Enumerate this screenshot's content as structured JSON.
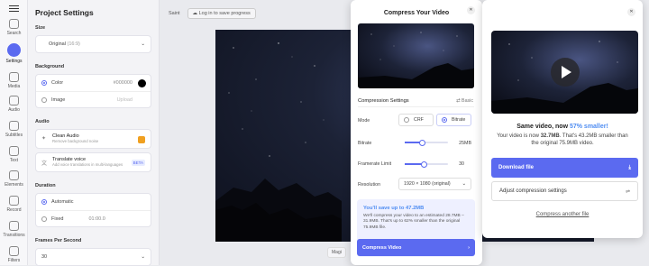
{
  "rail": {
    "items": [
      {
        "label": "Search",
        "icon": "search-icon"
      },
      {
        "label": "Settings",
        "icon": "settings-icon"
      },
      {
        "label": "Media",
        "icon": "plus-icon"
      },
      {
        "label": "Audio",
        "icon": "music-icon"
      },
      {
        "label": "Subtitles",
        "icon": "subtitles-icon"
      },
      {
        "label": "Text",
        "icon": "text-icon"
      },
      {
        "label": "Elements",
        "icon": "elements-icon"
      },
      {
        "label": "Record",
        "icon": "record-icon"
      },
      {
        "label": "Transitions",
        "icon": "transitions-icon"
      },
      {
        "label": "Filters",
        "icon": "filters-icon"
      }
    ]
  },
  "settings": {
    "title": "Project Settings",
    "size_label": "Size",
    "size_value": "Original",
    "size_ratio": "(16:9)",
    "background_label": "Background",
    "color_label": "Color",
    "color_value": "#000000",
    "image_label": "Image",
    "upload_label": "Upload",
    "audio_label": "Audio",
    "clean_audio_title": "Clean Audio",
    "clean_audio_desc": "Remove background noise",
    "translate_title": "Translate voice",
    "translate_desc": "Add voice translations in multi-languages",
    "beta_badge": "BETA",
    "duration_label": "Duration",
    "automatic_label": "Automatic",
    "fixed_label": "Fixed",
    "fixed_value": "01:00.0",
    "fps_label": "Frames Per Second",
    "fps_value": "30"
  },
  "topbar": {
    "project_name": "Saint",
    "save_label": "Log in to save progress"
  },
  "canvas": {
    "magic_label": "Magi"
  },
  "compress": {
    "title": "Compress Your Video",
    "settings_label": "Compression Settings",
    "basic_label": "Basic",
    "mode_label": "Mode",
    "crf_label": "CRF",
    "bitrate_option": "Bitrate",
    "bitrate_label": "Bitrate",
    "bitrate_value": "25MB",
    "bitrate_level": 0.4,
    "framerate_label": "Framerate Limit",
    "framerate_value": "30",
    "framerate_level": 0.45,
    "resolution_label": "Resolution",
    "resolution_value": "1920 × 1080 (original)",
    "save_title": "You'll save up to 47.2MB",
    "save_text": "We'll compress your video to an estimated 28.7MB – 31.9MB. That's up to 62% smaller than the original 75.9MB file.",
    "cta_label": "Compress Video"
  },
  "result": {
    "headline_prefix": "Same video, now ",
    "headline_highlight": "57% smaller!",
    "desc_prefix": "Your video is now ",
    "desc_size": "32.7MB",
    "desc_suffix": ". That's 43.2MB smaller than the original 75.9MB video.",
    "download_label": "Download file",
    "adjust_label": "Adjust compression settings",
    "another_label": "Compress another file"
  },
  "colors": {
    "accent": "#5b6af0",
    "highlight": "#4f8df2"
  }
}
